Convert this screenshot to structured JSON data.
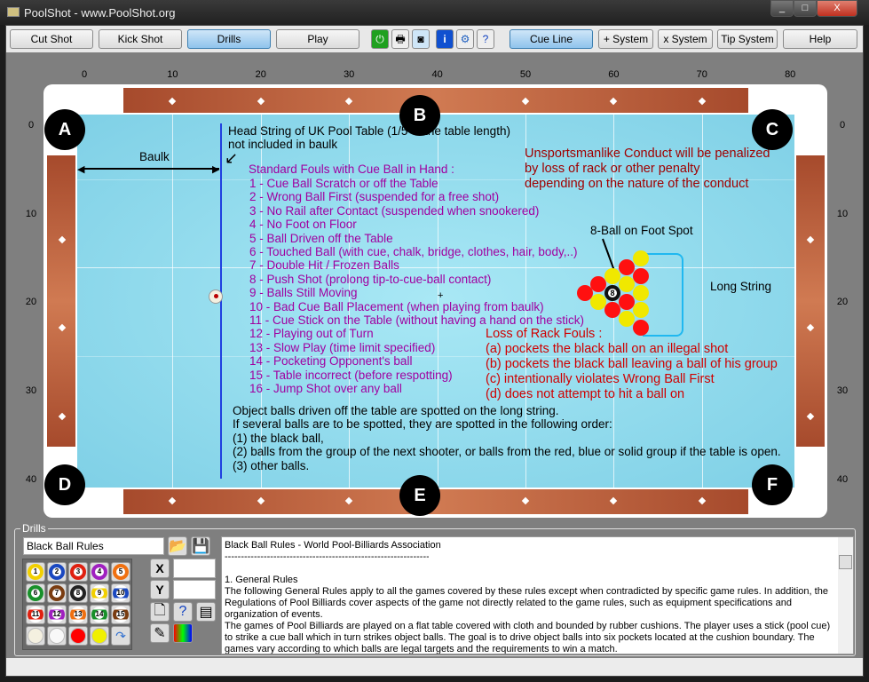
{
  "window": {
    "title": "PoolShot - www.PoolShot.org",
    "controls": [
      "_",
      "□",
      "X"
    ]
  },
  "toolbar": {
    "buttons": [
      "Cut Shot",
      "Kick Shot",
      "Drills",
      "Play"
    ],
    "active": "Drills",
    "icons": [
      "power-icon",
      "printer-icon",
      "camera-icon",
      "info-icon",
      "gear-icon",
      "help-document-icon"
    ],
    "right_buttons": [
      "Cue Line",
      "+ System",
      "x System",
      "Tip System",
      "Help"
    ]
  },
  "table": {
    "x_ticks": [
      "0",
      "10",
      "20",
      "30",
      "40",
      "50",
      "60",
      "70",
      "80"
    ],
    "y_ticks": [
      "0",
      "10",
      "20",
      "30",
      "40"
    ],
    "pockets": [
      "A",
      "B",
      "C",
      "D",
      "E",
      "F"
    ],
    "colors": {
      "cloth": "#8fdcef",
      "rail": "#c0653f",
      "head_string": "#2040e0",
      "purple_text": "#a000a0",
      "dark_red_text": "#a00000",
      "red_text": "#d00000"
    },
    "head_string_note": [
      "Head String of UK Pool Table (1/5 of the table length)",
      "not included in baulk"
    ],
    "baulk_label": "Baulk",
    "fouls_title": "Standard Fouls with Cue Ball in Hand :",
    "fouls": [
      "1 - Cue Ball Scratch or off the Table",
      "2 - Wrong Ball First (suspended for a free shot)",
      "3 - No Rail after Contact (suspended when snookered)",
      "4 - No Foot on Floor",
      "5 - Ball Driven off the Table",
      "6 - Touched Ball (with cue, chalk, bridge, clothes, hair, body,..)",
      "7 - Double Hit / Frozen Balls",
      "8 - Push Shot (prolong tip-to-cue-ball contact)",
      "9 - Balls Still Moving",
      "10 - Bad Cue Ball Placement (when playing from baulk)",
      "11 - Cue Stick on the Table (without having a hand on the stick)",
      "12 - Playing out of Turn",
      "13 - Slow Play (time limit specified)",
      "14 - Pocketing Opponent's ball",
      "15 - Table incorrect (before respotting)",
      "16 - Jump Shot over any ball"
    ],
    "unsportsmanlike": [
      "Unsportsmanlike Conduct will be penalized",
      "by loss of rack or other penalty",
      "depending on the nature of the conduct"
    ],
    "foot_spot_label": "8-Ball on Foot Spot",
    "long_string_label": "Long String",
    "loss_title": "Loss of Rack Fouls :",
    "loss": [
      "(a) pockets the black ball on an illegal shot",
      "(b) pockets the black ball leaving a ball of his group",
      "(c) intentionally violates Wrong Ball First",
      "(d) does not attempt to hit a ball on"
    ],
    "spotting": [
      "Object balls driven off the table are spotted on the long string.",
      "If several balls are to be spotted, they are spotted in the following order:",
      "(1) the black ball,",
      "(2) balls from the group of the next shooter, or balls from the red, blue or solid group if the table is open.",
      "(3) other balls."
    ],
    "eight_ball_label": "8",
    "rack": [
      [
        "red"
      ],
      [
        "red",
        "yellow"
      ],
      [
        "yellow",
        "black",
        "red"
      ],
      [
        "red",
        "yellow",
        "red",
        "yellow"
      ],
      [
        "yellow",
        "red",
        "yellow",
        "yellow",
        "red"
      ]
    ]
  },
  "drills": {
    "legend": "Drills",
    "name_value": "Black Ball Rules",
    "x_label": "X",
    "y_label": "Y",
    "x_value": "",
    "y_value": "",
    "balls": [
      "1",
      "2",
      "3",
      "4",
      "5",
      "6",
      "7",
      "8",
      "9",
      "10",
      "11",
      "12",
      "13",
      "14",
      "15"
    ],
    "ball_colors": [
      "#f2d000",
      "#1a48c0",
      "#e02010",
      "#a020c0",
      "#f07010",
      "#18902a",
      "#7a3c10",
      "#222222",
      "#f2d000",
      "#1a48c0",
      "#e02010",
      "#a020c0",
      "#f07010",
      "#18902a",
      "#7a3c10"
    ],
    "rules_title": "Black Ball Rules - World Pool-Billiards Association",
    "rules_sep": "--------------------------------------------------------------------------------",
    "rules_heading": "1. General Rules",
    "rules_p1": "The following General Rules apply to all the games covered by these rules except when contradicted by specific game rules. In addition, the Regulations of Pool Billiards cover aspects of the game not directly related to the game rules, such as equipment specifications and organization of events.",
    "rules_p2": "The games of Pool Billiards are played on a flat table covered with cloth and bounded by rubber cushions. The player uses a stick (pool cue) to strike a cue ball which in turn strikes object balls. The goal is to drive object balls into six pockets located at the cushion boundary. The games vary according to which balls are legal targets and the requirements to win a match."
  }
}
